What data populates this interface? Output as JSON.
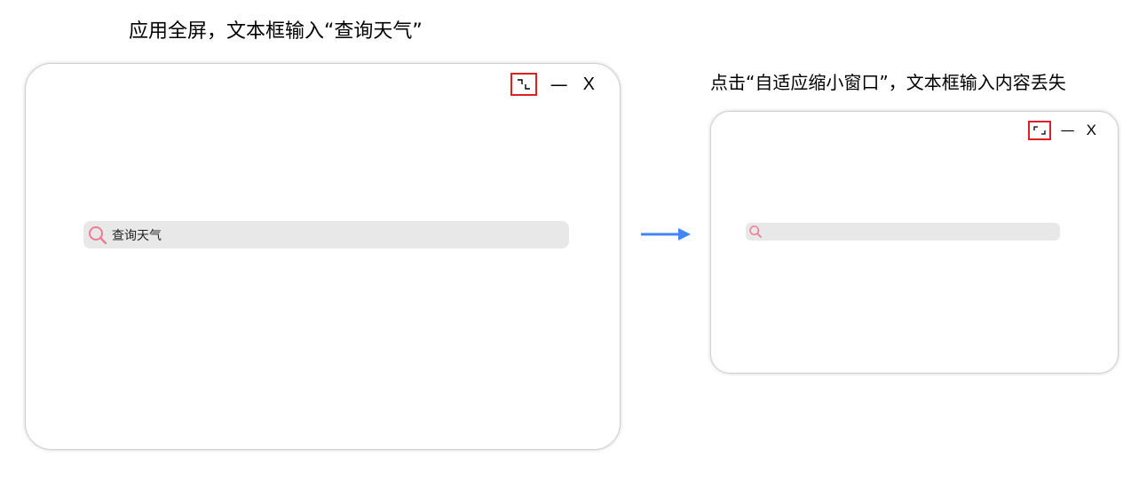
{
  "captions": {
    "left": "应用全屏，文本框输入“查询天气”",
    "right": "点击“自适应缩小窗口”，文本框输入内容丢失"
  },
  "fullscreen_window": {
    "controls": {
      "resize_icon": "exit-fullscreen-icon",
      "minimize_label": "—",
      "close_label": "X"
    },
    "search": {
      "icon": "search-icon",
      "value": "查询天气"
    }
  },
  "small_window": {
    "controls": {
      "resize_icon": "enter-fullscreen-icon",
      "minimize_label": "—",
      "close_label": "X"
    },
    "search": {
      "icon": "search-icon",
      "value": ""
    }
  },
  "colors": {
    "highlight_border": "#e02020",
    "search_icon": "#f07b95",
    "arrow": "#3f87f5",
    "searchbar_bg": "#e8e8e8"
  }
}
